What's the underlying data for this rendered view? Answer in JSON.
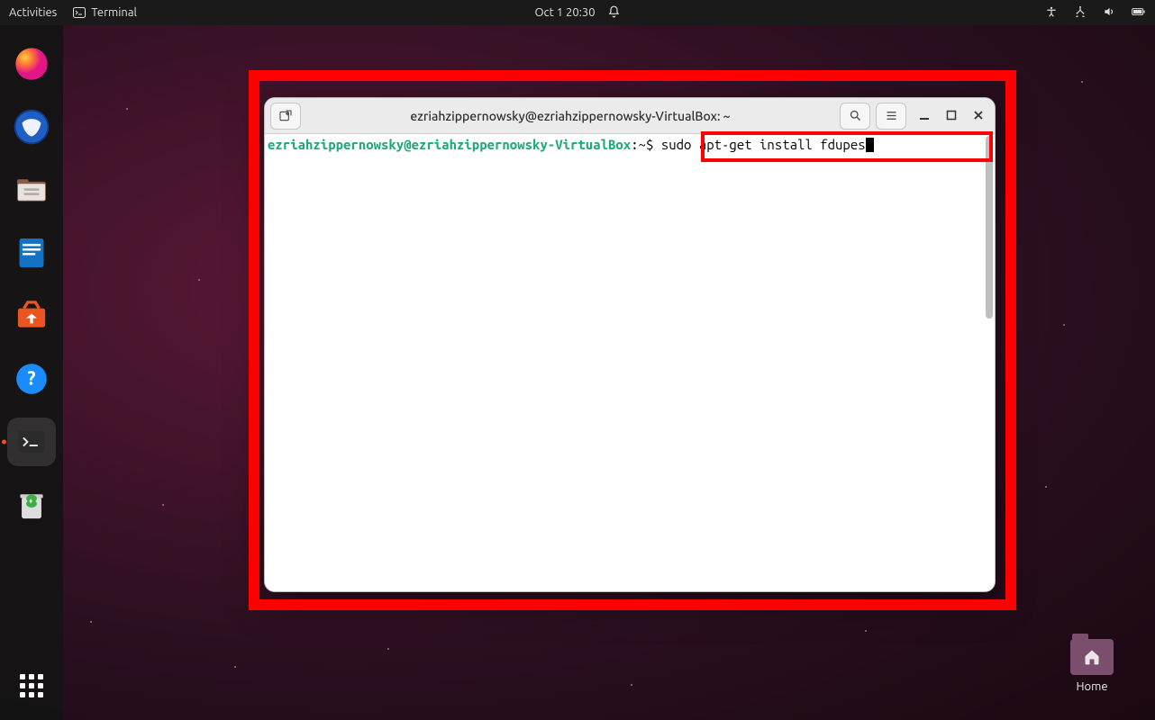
{
  "topbar": {
    "activities": "Activities",
    "app_name": "Terminal",
    "datetime": "Oct 1  20:30"
  },
  "dock": {
    "items": [
      {
        "name": "firefox"
      },
      {
        "name": "thunderbird"
      },
      {
        "name": "files"
      },
      {
        "name": "writer"
      },
      {
        "name": "software"
      },
      {
        "name": "help"
      },
      {
        "name": "terminal"
      },
      {
        "name": "trash"
      }
    ]
  },
  "desktop": {
    "home_label": "Home"
  },
  "terminal": {
    "title": "ezriahzippernowsky@ezriahzippernowsky-VirtualBox: ~",
    "prompt_user": "ezriahzippernowsky@ezriahzippernowsky-VirtualBox",
    "prompt_sep": ":",
    "prompt_path": "~$",
    "command": " sudo apt-get install fdupes"
  }
}
